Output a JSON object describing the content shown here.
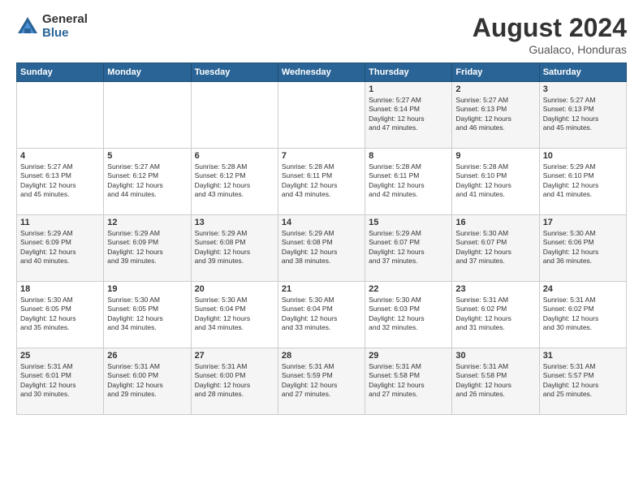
{
  "header": {
    "logo_general": "General",
    "logo_blue": "Blue",
    "month_title": "August 2024",
    "location": "Gualaco, Honduras"
  },
  "days_of_week": [
    "Sunday",
    "Monday",
    "Tuesday",
    "Wednesday",
    "Thursday",
    "Friday",
    "Saturday"
  ],
  "weeks": [
    [
      {
        "day": "",
        "info": ""
      },
      {
        "day": "",
        "info": ""
      },
      {
        "day": "",
        "info": ""
      },
      {
        "day": "",
        "info": ""
      },
      {
        "day": "1",
        "info": "Sunrise: 5:27 AM\nSunset: 6:14 PM\nDaylight: 12 hours\nand 47 minutes."
      },
      {
        "day": "2",
        "info": "Sunrise: 5:27 AM\nSunset: 6:13 PM\nDaylight: 12 hours\nand 46 minutes."
      },
      {
        "day": "3",
        "info": "Sunrise: 5:27 AM\nSunset: 6:13 PM\nDaylight: 12 hours\nand 45 minutes."
      }
    ],
    [
      {
        "day": "4",
        "info": "Sunrise: 5:27 AM\nSunset: 6:13 PM\nDaylight: 12 hours\nand 45 minutes."
      },
      {
        "day": "5",
        "info": "Sunrise: 5:27 AM\nSunset: 6:12 PM\nDaylight: 12 hours\nand 44 minutes."
      },
      {
        "day": "6",
        "info": "Sunrise: 5:28 AM\nSunset: 6:12 PM\nDaylight: 12 hours\nand 43 minutes."
      },
      {
        "day": "7",
        "info": "Sunrise: 5:28 AM\nSunset: 6:11 PM\nDaylight: 12 hours\nand 43 minutes."
      },
      {
        "day": "8",
        "info": "Sunrise: 5:28 AM\nSunset: 6:11 PM\nDaylight: 12 hours\nand 42 minutes."
      },
      {
        "day": "9",
        "info": "Sunrise: 5:28 AM\nSunset: 6:10 PM\nDaylight: 12 hours\nand 41 minutes."
      },
      {
        "day": "10",
        "info": "Sunrise: 5:29 AM\nSunset: 6:10 PM\nDaylight: 12 hours\nand 41 minutes."
      }
    ],
    [
      {
        "day": "11",
        "info": "Sunrise: 5:29 AM\nSunset: 6:09 PM\nDaylight: 12 hours\nand 40 minutes."
      },
      {
        "day": "12",
        "info": "Sunrise: 5:29 AM\nSunset: 6:09 PM\nDaylight: 12 hours\nand 39 minutes."
      },
      {
        "day": "13",
        "info": "Sunrise: 5:29 AM\nSunset: 6:08 PM\nDaylight: 12 hours\nand 39 minutes."
      },
      {
        "day": "14",
        "info": "Sunrise: 5:29 AM\nSunset: 6:08 PM\nDaylight: 12 hours\nand 38 minutes."
      },
      {
        "day": "15",
        "info": "Sunrise: 5:29 AM\nSunset: 6:07 PM\nDaylight: 12 hours\nand 37 minutes."
      },
      {
        "day": "16",
        "info": "Sunrise: 5:30 AM\nSunset: 6:07 PM\nDaylight: 12 hours\nand 37 minutes."
      },
      {
        "day": "17",
        "info": "Sunrise: 5:30 AM\nSunset: 6:06 PM\nDaylight: 12 hours\nand 36 minutes."
      }
    ],
    [
      {
        "day": "18",
        "info": "Sunrise: 5:30 AM\nSunset: 6:05 PM\nDaylight: 12 hours\nand 35 minutes."
      },
      {
        "day": "19",
        "info": "Sunrise: 5:30 AM\nSunset: 6:05 PM\nDaylight: 12 hours\nand 34 minutes."
      },
      {
        "day": "20",
        "info": "Sunrise: 5:30 AM\nSunset: 6:04 PM\nDaylight: 12 hours\nand 34 minutes."
      },
      {
        "day": "21",
        "info": "Sunrise: 5:30 AM\nSunset: 6:04 PM\nDaylight: 12 hours\nand 33 minutes."
      },
      {
        "day": "22",
        "info": "Sunrise: 5:30 AM\nSunset: 6:03 PM\nDaylight: 12 hours\nand 32 minutes."
      },
      {
        "day": "23",
        "info": "Sunrise: 5:31 AM\nSunset: 6:02 PM\nDaylight: 12 hours\nand 31 minutes."
      },
      {
        "day": "24",
        "info": "Sunrise: 5:31 AM\nSunset: 6:02 PM\nDaylight: 12 hours\nand 30 minutes."
      }
    ],
    [
      {
        "day": "25",
        "info": "Sunrise: 5:31 AM\nSunset: 6:01 PM\nDaylight: 12 hours\nand 30 minutes."
      },
      {
        "day": "26",
        "info": "Sunrise: 5:31 AM\nSunset: 6:00 PM\nDaylight: 12 hours\nand 29 minutes."
      },
      {
        "day": "27",
        "info": "Sunrise: 5:31 AM\nSunset: 6:00 PM\nDaylight: 12 hours\nand 28 minutes."
      },
      {
        "day": "28",
        "info": "Sunrise: 5:31 AM\nSunset: 5:59 PM\nDaylight: 12 hours\nand 27 minutes."
      },
      {
        "day": "29",
        "info": "Sunrise: 5:31 AM\nSunset: 5:58 PM\nDaylight: 12 hours\nand 27 minutes."
      },
      {
        "day": "30",
        "info": "Sunrise: 5:31 AM\nSunset: 5:58 PM\nDaylight: 12 hours\nand 26 minutes."
      },
      {
        "day": "31",
        "info": "Sunrise: 5:31 AM\nSunset: 5:57 PM\nDaylight: 12 hours\nand 25 minutes."
      }
    ]
  ]
}
